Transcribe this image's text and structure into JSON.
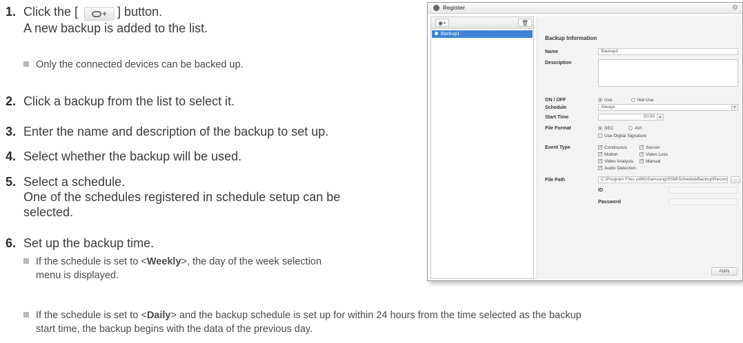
{
  "manual": {
    "step1": {
      "num": "1.",
      "before": "Click the [",
      "after": "] button.",
      "line2": "A new backup is added to the list.",
      "note": "Only the connected devices can be backed up.",
      "button_icon": "camera-plus-icon"
    },
    "step2": {
      "num": "2.",
      "text": "Click a backup from the list to select it."
    },
    "step3": {
      "num": "3.",
      "text": "Enter the name and description of the backup to set up."
    },
    "step4": {
      "num": "4.",
      "text": "Select whether the backup will be used."
    },
    "step5": {
      "num": "5.",
      "text": "Select a schedule.",
      "line2": "One of the schedules registered in schedule setup can be",
      "line3": "selected."
    },
    "step6": {
      "num": "6.",
      "text": "Set up the backup time.",
      "note1_a": "If the schedule is set to <",
      "note1_bold": "Weekly",
      "note1_b": ">, the day of the week selection",
      "note1_line2": "menu is displayed.",
      "note2_a": "If the schedule is set to <",
      "note2_bold": "Daily",
      "note2_b": "> and the backup schedule is set up for within 24 hours from the time selected as the backup",
      "note2_line2": "start time, the backup begins with the data of the previous day."
    }
  },
  "window": {
    "title": "Register",
    "backup_item": "Backup1",
    "section_title": "Backup Information",
    "labels": {
      "name": "Name",
      "description": "Description",
      "on_off": "ON / OFF",
      "schedule": "Schedule",
      "start_time": "Start Time",
      "file_format": "File Format",
      "event_type": "Event Type",
      "file_path": "File Path",
      "id": "ID",
      "password": "Password"
    },
    "values": {
      "name": "Backup1",
      "schedule": "Always",
      "start_time": "00:00",
      "file_path": "C:\\Program Files (x86)\\Samsung\\SSM\\ScheduleBackup\\Record",
      "browse": "..."
    },
    "options": {
      "use": "Use",
      "not_use": "Not Use",
      "sec": "SEC",
      "avi": "AVI",
      "digital_signature": "Use Digital Signature",
      "continuous": "Continuous",
      "sensor": "Sensor",
      "motion": "Motion",
      "video_loss": "Video Loss",
      "video_analysis": "Video Analysis",
      "manual": "Manual",
      "audio_detection": "Audio Detection"
    },
    "apply": "Apply"
  }
}
